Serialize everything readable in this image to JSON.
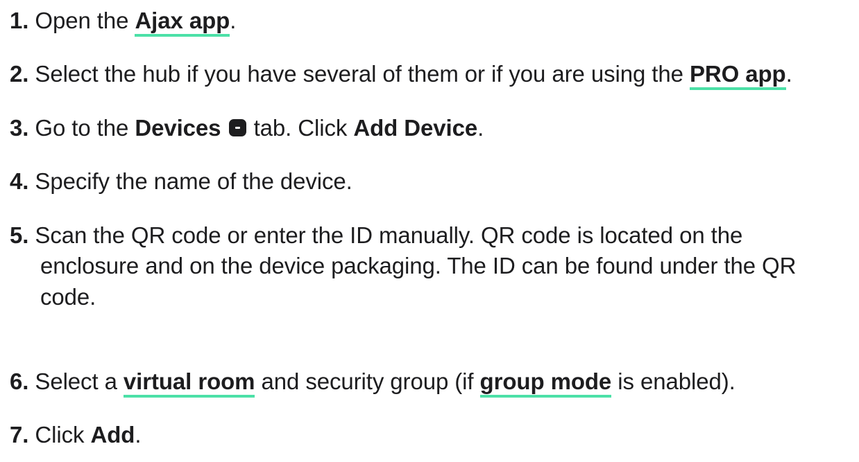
{
  "steps": [
    {
      "number": "1.",
      "parts": {
        "a": "Open the ",
        "link": "Ajax app",
        "b": "."
      }
    },
    {
      "number": "2.",
      "parts": {
        "a": "Select the hub if you have several of them or if you are using the ",
        "link": "PRO app",
        "b": "."
      }
    },
    {
      "number": "3.",
      "parts": {
        "a": "Go to the ",
        "bold1": "Devices",
        "b": " tab. Click ",
        "bold2": "Add Device",
        "c": "."
      },
      "icon": "devices-tab-icon"
    },
    {
      "number": "4.",
      "parts": {
        "a": "Specify the name of the device."
      }
    },
    {
      "number": "5.",
      "lines": [
        "Scan the QR code or enter the ID manually. QR code is located on the",
        "enclosure and on the device packaging. The ID can be found under the QR",
        "code."
      ]
    },
    {
      "number": "6.",
      "parts": {
        "a": "Select a ",
        "link1": "virtual room",
        "b": " and security group (if ",
        "link2": "group mode",
        "c": " is enabled)."
      }
    },
    {
      "number": "7.",
      "parts": {
        "a": "Click ",
        "bold1": "Add",
        "b": "."
      }
    }
  ],
  "colors": {
    "text": "#1d1d1f",
    "link_underline": "#4ce0a7",
    "background": "#ffffff"
  }
}
